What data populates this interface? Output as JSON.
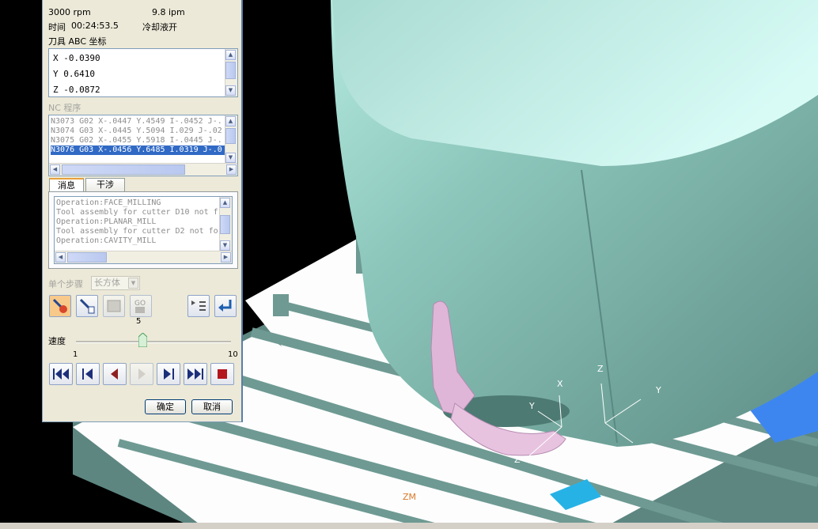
{
  "status": {
    "spindle": "3000 rpm",
    "feed": "9.8 ipm",
    "time_label": "时间",
    "time_value": "00:24:53.5",
    "coolant": "冷却液开",
    "tool_coords_label": "刀具 ABC 坐标"
  },
  "coords": [
    "X -0.0390",
    "Y 0.6410",
    "Z -0.0872"
  ],
  "nc_program": {
    "label": "NC 程序",
    "lines": [
      "N3073 G02 X-.0447 Y.4549 I-.0452 J-.",
      "N3074 G03 X-.0445 Y.5094 I.029 J-.02",
      "N3075 G02 X-.0455 Y.5918 I-.0445 J-.",
      "N3076 G03 X-.0456 Y.6485 I.0319 J-.0"
    ],
    "selected_index": 3
  },
  "tabs": [
    "消息",
    "干涉"
  ],
  "active_tab": 0,
  "messages": [
    "Operation:FACE_MILLING",
    "Tool assembly for cutter D10 not f",
    "Operation:PLANAR_MILL",
    "Tool assembly for cutter D2 not fo",
    "Operation:CAVITY_MILL"
  ],
  "step": {
    "label": "单个步骤",
    "value": "长方体"
  },
  "toolbar_icons": [
    "show-tool-icon",
    "show-holder-icon",
    "show-machine-icon",
    "go-to-icon",
    "step-list-icon",
    "return-icon"
  ],
  "speed": {
    "label": "速度",
    "value": "5",
    "min": "1",
    "max": "10",
    "level": 5
  },
  "playback_icons": [
    "first-icon",
    "prev-op-icon",
    "step-back-icon",
    "play-icon",
    "step-forward-icon",
    "last-icon",
    "stop-icon"
  ],
  "buttons": {
    "ok": "确定",
    "cancel": "取消"
  },
  "axes_labels": {
    "x": "X",
    "y": "Y",
    "z": "Z",
    "zm": "ZM"
  },
  "colors": {
    "spindle_head": "#79b0a6",
    "table": "#ffffff",
    "fixture": "#e0b6d8",
    "workpiece": "#27b2e6",
    "selection": "#316ac5"
  }
}
